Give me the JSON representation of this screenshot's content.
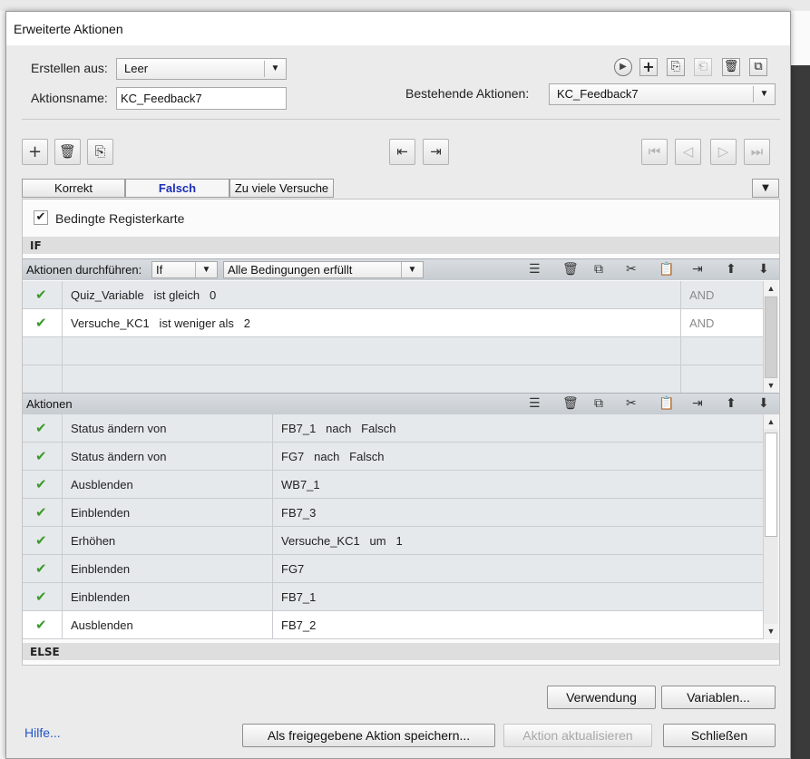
{
  "window": {
    "title": "Erweiterte Aktionen"
  },
  "form": {
    "create_from_label": "Erstellen aus:",
    "create_from_value": "Leer",
    "action_name_label": "Aktionsname:",
    "action_name_value": "KC_Feedback7",
    "existing_label": "Bestehende Aktionen:",
    "existing_value": "KC_Feedback7"
  },
  "tabs": [
    {
      "label": "Korrekt",
      "active": false
    },
    {
      "label": "Falsch",
      "active": true
    },
    {
      "label": "Zu viele Versuche",
      "active": false
    }
  ],
  "conditional": {
    "label": "Bedingte Registerkarte",
    "checked": true
  },
  "if_section": {
    "label": "IF",
    "perform_label": "Aktionen durchführen:",
    "perform_value": "If",
    "condition_value": "Alle Bedingungen erfüllt",
    "rows": [
      {
        "check": "✔",
        "text": "Quiz_Variable   ist gleich   0",
        "op": "AND"
      },
      {
        "check": "✔",
        "text": "Versuche_KC1   ist weniger als   2",
        "op": "AND"
      },
      {
        "check": "",
        "text": "",
        "op": ""
      },
      {
        "check": "",
        "text": "",
        "op": ""
      }
    ]
  },
  "actions_section": {
    "label": "Aktionen",
    "rows": [
      {
        "check": "✔",
        "action": "Status ändern von",
        "target": "FB7_1   nach   Falsch"
      },
      {
        "check": "✔",
        "action": "Status ändern von",
        "target": "FG7   nach   Falsch"
      },
      {
        "check": "✔",
        "action": "Ausblenden",
        "target": "WB7_1"
      },
      {
        "check": "✔",
        "action": "Einblenden",
        "target": "FB7_3"
      },
      {
        "check": "✔",
        "action": "Erhöhen",
        "target": "Versuche_KC1   um   1"
      },
      {
        "check": "✔",
        "action": "Einblenden",
        "target": "FG7"
      },
      {
        "check": "✔",
        "action": "Einblenden",
        "target": "FB7_1"
      },
      {
        "check": "✔",
        "action": "Ausblenden",
        "target": "FB7_2"
      }
    ]
  },
  "else_section": {
    "label": "ELSE"
  },
  "buttons": {
    "usage": "Verwendung",
    "variables": "Variablen...",
    "help": "Hilfe...",
    "save_shared": "Als freigegebene Aktion speichern...",
    "update": "Aktion aktualisieren",
    "close": "Schließen"
  }
}
